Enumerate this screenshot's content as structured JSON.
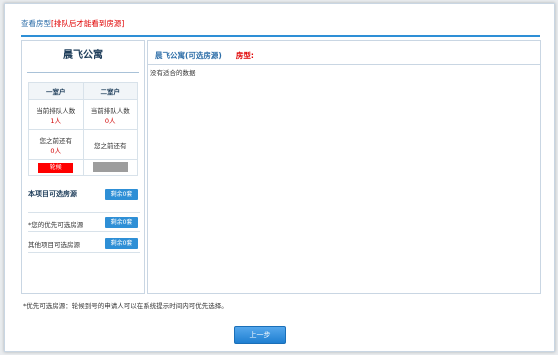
{
  "header": {
    "prefix": "查看房型",
    "note": "[排队后才能看到房源]"
  },
  "project": {
    "name": "晨飞公寓"
  },
  "unit_types": [
    {
      "label": "一室户",
      "queue_label": "当前排队人数",
      "queue_count": "1人",
      "ahead_label": "您之前还有",
      "ahead_count": "0人",
      "action_label": "轮候"
    },
    {
      "label": "二室户",
      "queue_label": "当前排队人数",
      "queue_count": "0人",
      "ahead_label": "您之前还有",
      "ahead_count": "",
      "action_label": ""
    }
  ],
  "sections": {
    "this_project": {
      "label": "本项目可选房源",
      "button": "剩余0套"
    },
    "priority": {
      "label": "*您的优先可选房源",
      "button": "剩余0套"
    },
    "other": {
      "label": "其他项目可选房源",
      "button": "剩余0套"
    }
  },
  "right_panel": {
    "title": "晨飞公寓(可选房源)",
    "type_label": "房型:",
    "empty_text": "没有适合的数据"
  },
  "footer": {
    "note": "*优先可选房源：轮候到号的申请人可以在系统提示时间内可优先选择。",
    "back_label": "上一步"
  },
  "colors": {
    "accent": "#2e8fd6",
    "alert": "#ff0000",
    "disabled": "#9d9d9d"
  }
}
